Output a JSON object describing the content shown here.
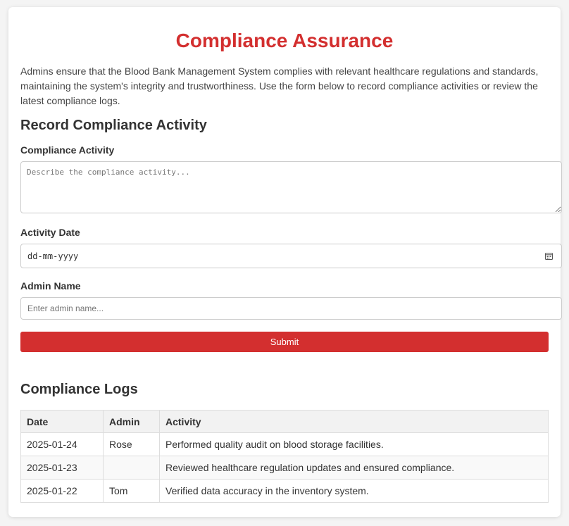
{
  "page": {
    "title": "Compliance Assurance",
    "intro": "Admins ensure that the Blood Bank Management System complies with relevant healthcare regulations and standards, maintaining the system's integrity and trustworthiness. Use the form below to record compliance activities or review the latest compliance logs."
  },
  "form": {
    "title": "Record Compliance Activity",
    "activity_label": "Compliance Activity",
    "activity_placeholder": "Describe the compliance activity...",
    "date_label": "Activity Date",
    "date_placeholder": "dd-mm-yyyy",
    "admin_label": "Admin Name",
    "admin_placeholder": "Enter admin name...",
    "submit_label": "Submit"
  },
  "logs": {
    "title": "Compliance Logs",
    "headers": [
      "Date",
      "Admin",
      "Activity"
    ],
    "rows": [
      {
        "date": "2025-01-24",
        "admin": "Rose",
        "activity": "Performed quality audit on blood storage facilities."
      },
      {
        "date": "2025-01-23",
        "admin": "",
        "activity": "Reviewed healthcare regulation updates and ensured compliance."
      },
      {
        "date": "2025-01-22",
        "admin": "Tom",
        "activity": "Verified data accuracy in the inventory system."
      }
    ]
  },
  "icons": {
    "date_picker": "calendar-icon"
  },
  "colors": {
    "accent": "#d32f2f",
    "text": "#333333",
    "border": "#cccccc",
    "header_bg": "#f2f2f2"
  }
}
